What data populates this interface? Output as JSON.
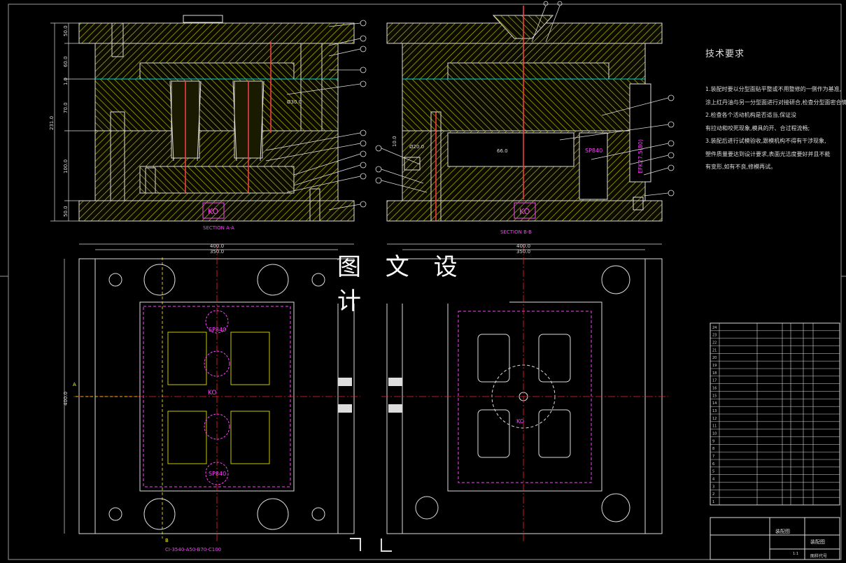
{
  "watermark": "图 文 设 计",
  "tech_requirements": {
    "title": "技术要求",
    "lines": [
      "1.装配时要以分型面贴平整或不用整修的一侧作为基准,",
      "涂上红丹油与另一分型面进行对接研合,检查分型面密合情况;",
      "2.检查各个活动机构是否适当,保证没",
      "有拉动和咬死现象,模具的开、合过程流畅;",
      "3.装配后进行试模验收,跟模机构不得有干涉现象,",
      "塑件质量要达到设计要求,表面光洁度要好并且不能",
      "有变形,如有不良,修模再试。"
    ]
  },
  "section_labels": {
    "aa": "SECTION A-A",
    "bb": "SECTION B-B"
  },
  "dims": {
    "left_top": [
      "50.0",
      "60.0",
      "1.0",
      "70.0",
      "231.0",
      "100.0",
      "50.0"
    ],
    "plan_w1": "400.0",
    "plan_w2": "350.0",
    "plan_h": "400.0",
    "bb_w1": "400.0",
    "bb_w2": "350.0",
    "hole1": "Ø30.0",
    "hole2": "Ø20.0",
    "len": "66.0",
    "h10": "10.0"
  },
  "marks": {
    "sp_a": "SP840",
    "sp_b": "SP840",
    "sp_plan_top": "SP840",
    "sp_plan_bot": "SP840",
    "ko_a": "KO",
    "ko_b": "KO",
    "ko_plan": "KO",
    "ko_bb_plan": "KO",
    "ek_spec": "EFK27.5(80)",
    "model": "CI-3540-A50-B70-C100",
    "sec_a": "A",
    "sec_b": "B"
  },
  "title_block": {
    "name": "装配图",
    "subtitle": "装配图",
    "code": "图样代号",
    "scale": "1:1"
  },
  "bom_count": 24,
  "colors": {
    "bg": "#000000",
    "hatch": "#c8c800",
    "line": "#e8e8e8",
    "center": "#ff2020",
    "dim": "#e0e0e0",
    "magenta": "#ff40ff",
    "cyan": "#00e0e0",
    "gray": "#7a7a7a"
  }
}
